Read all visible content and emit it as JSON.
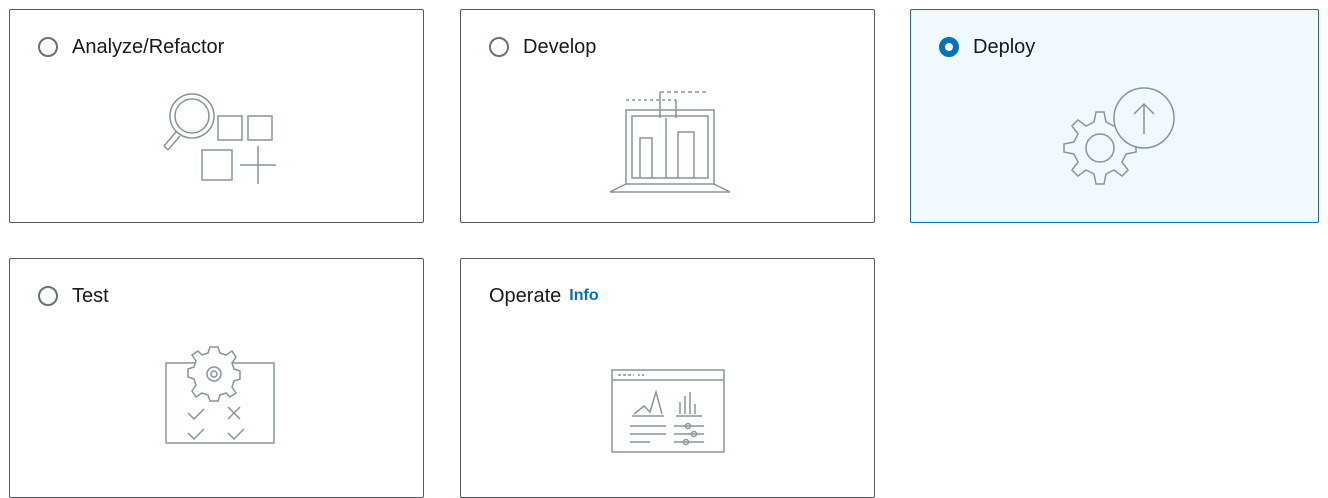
{
  "options": [
    {
      "label": "Analyze/Refactor",
      "selected": false,
      "icon": "analyze-refactor-icon"
    },
    {
      "label": "Develop",
      "selected": false,
      "icon": "develop-laptop-icon"
    },
    {
      "label": "Deploy",
      "selected": true,
      "icon": "deploy-gear-upload-icon"
    },
    {
      "label": "Test",
      "selected": false,
      "icon": "test-checklist-icon"
    },
    {
      "label": "Operate",
      "info_link": "Info",
      "icon": "operate-dashboard-icon"
    }
  ],
  "colors": {
    "accent": "#0073bb",
    "selected_background": "#f1faff",
    "border": "#545b64",
    "illustration": "#879596"
  }
}
